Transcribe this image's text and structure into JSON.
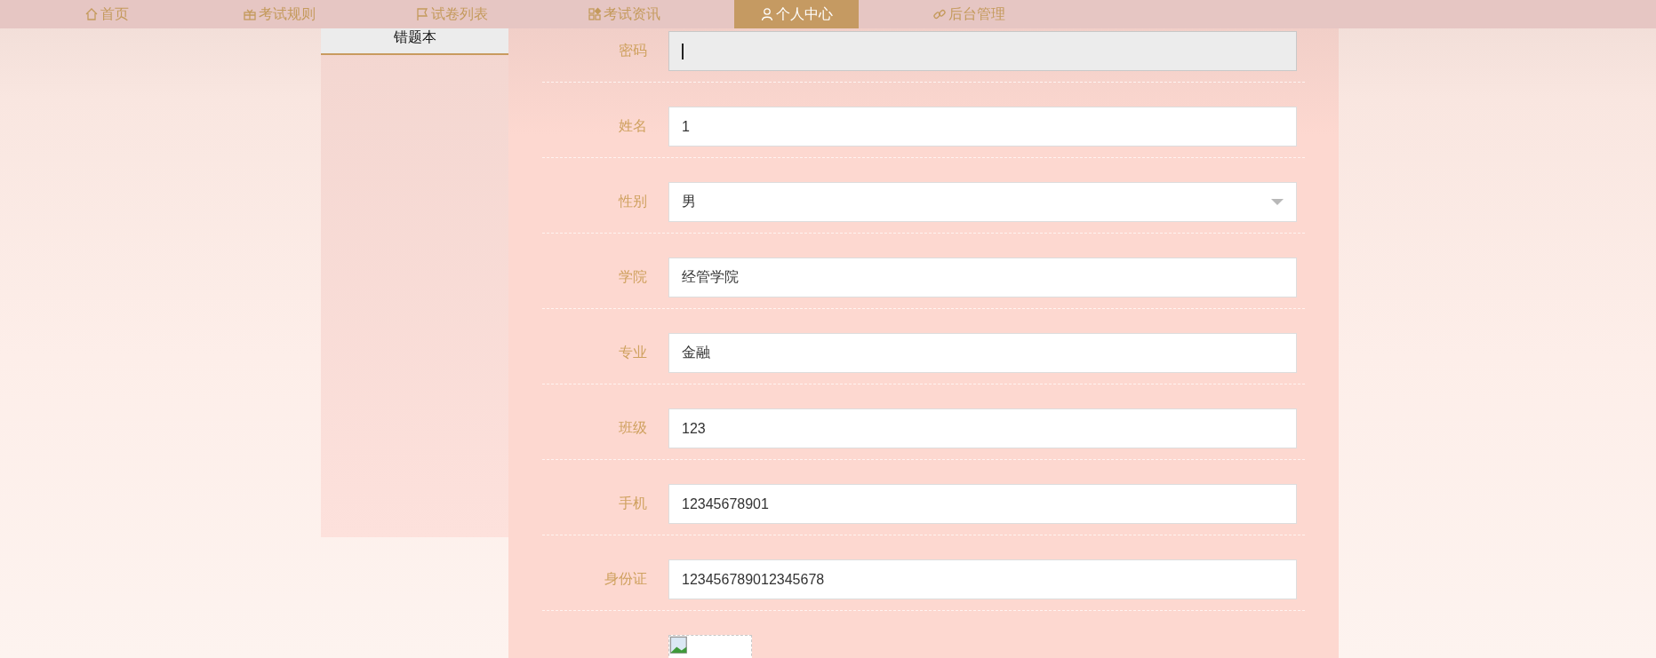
{
  "nav": {
    "items": [
      {
        "label": "首页",
        "selected": false
      },
      {
        "label": "考试规则",
        "selected": false
      },
      {
        "label": "试卷列表",
        "selected": false
      },
      {
        "label": "考试资讯",
        "selected": false
      },
      {
        "label": "个人中心",
        "selected": true
      },
      {
        "label": "后台管理",
        "selected": false
      }
    ]
  },
  "sidebar": {
    "items": [
      {
        "label": "错题本",
        "selected": true
      }
    ]
  },
  "form": {
    "fields": [
      {
        "label": "密码",
        "kind": "text",
        "disabled": true
      },
      {
        "label": "姓名",
        "kind": "text",
        "value": "1",
        "disabled": false
      },
      {
        "label": "性别",
        "kind": "select",
        "value": "男",
        "disabled": false
      },
      {
        "label": "学院",
        "kind": "text",
        "value": "经管学院",
        "disabled": false
      },
      {
        "label": "专业",
        "kind": "text",
        "value": "金融",
        "disabled": false
      },
      {
        "label": "班级",
        "kind": "text",
        "value": "123",
        "disabled": false
      },
      {
        "label": "手机",
        "kind": "text",
        "value": "12345678901",
        "disabled": false
      },
      {
        "label": "身份证",
        "kind": "text",
        "value": "123456789012345678",
        "disabled": false
      },
      {
        "kind": "image"
      }
    ]
  }
}
